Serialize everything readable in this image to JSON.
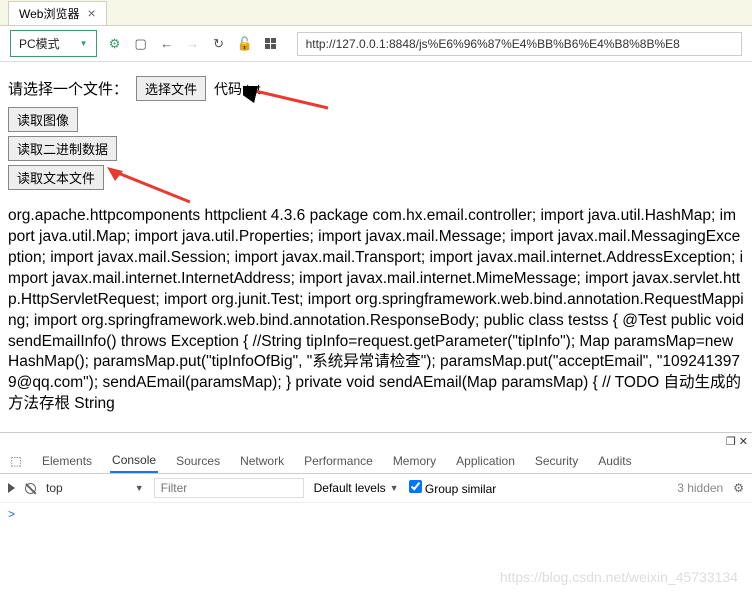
{
  "tab": {
    "title": "Web浏览器",
    "close": "×"
  },
  "toolbar": {
    "mode": "PC模式",
    "url": "http://127.0.0.1:8848/js%E6%96%87%E4%BB%B6%E4%B8%8B%E8"
  },
  "page": {
    "label": "请选择一个文件：",
    "choose_btn": "选择文件",
    "filename": "代码.txt",
    "btn_read_image": "读取图像",
    "btn_read_binary": "读取二进制数据",
    "btn_read_text": "读取文本文件",
    "text": "org.apache.httpcomponents httpclient 4.3.6 package com.hx.email.controller; import java.util.HashMap; import java.util.Map; import java.util.Properties; import javax.mail.Message; import javax.mail.MessagingException; import javax.mail.Session; import javax.mail.Transport; import javax.mail.internet.AddressException; import javax.mail.internet.InternetAddress; import javax.mail.internet.MimeMessage; import javax.servlet.http.HttpServletRequest; import org.junit.Test; import org.springframework.web.bind.annotation.RequestMapping; import org.springframework.web.bind.annotation.ResponseBody; public class testss { @Test public void sendEmailInfo() throws Exception { //String tipInfo=request.getParameter(\"tipInfo\"); Map paramsMap=new HashMap(); paramsMap.put(\"tipInfoOfBig\", \"系统异常请检查\"); paramsMap.put(\"acceptEmail\", \"1092413979@qq.com\"); sendAEmail(paramsMap); } private void sendAEmail(Map paramsMap) { // TODO 自动生成的方法存根 String"
  },
  "devtools": {
    "tabs": [
      "Elements",
      "Console",
      "Sources",
      "Network",
      "Performance",
      "Memory",
      "Application",
      "Security",
      "Audits"
    ],
    "active_tab": 1,
    "context": "top",
    "filter_placeholder": "Filter",
    "levels": "Default levels",
    "group_similar": "Group similar",
    "hidden": "3 hidden",
    "prompt": ">"
  },
  "watermark": "https://blog.csdn.net/weixin_45733134"
}
